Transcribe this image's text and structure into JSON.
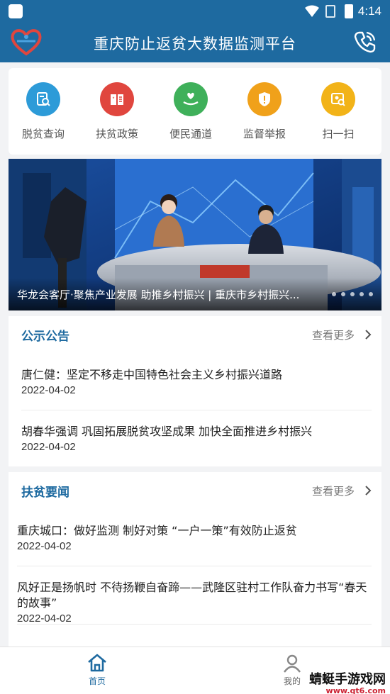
{
  "status": {
    "time": "4:14"
  },
  "app": {
    "title": "重庆防止返贫大数据监测平台"
  },
  "quick_menu": [
    {
      "label": "脱贫查询",
      "icon": "document-search-icon",
      "color": "#2d9bd8"
    },
    {
      "label": "扶贫政策",
      "icon": "policy-book-icon",
      "color": "#e0463e"
    },
    {
      "label": "便民通道",
      "icon": "hand-heart-icon",
      "color": "#3fb05a"
    },
    {
      "label": "监督举报",
      "icon": "shield-alert-icon",
      "color": "#f0a11a"
    },
    {
      "label": "扫一扫",
      "icon": "scan-icon",
      "color": "#f2b318"
    }
  ],
  "banner": {
    "caption": "华龙会客厅·聚焦产业发展 助推乡村振兴 | 重庆市乡村振兴..."
  },
  "announcements": {
    "title": "公示公告",
    "more": "查看更多",
    "items": [
      {
        "title": "唐仁健：坚定不移走中国特色社会主义乡村振兴道路",
        "date": "2022-04-02"
      },
      {
        "title": "胡春华强调 巩固拓展脱贫攻坚成果 加快全面推进乡村振兴",
        "date": "2022-04-02"
      }
    ]
  },
  "news": {
    "title": "扶贫要闻",
    "more": "查看更多",
    "items": [
      {
        "title": "重庆城口：做好监测 制好对策 “一户一策”有效防止返贫",
        "date": "2022-04-02"
      },
      {
        "title": "风好正是扬帆时 不待扬鞭自奋蹄——武隆区驻村工作队奋力书写“春天的故事”",
        "date": "2022-04-02"
      }
    ]
  },
  "nav": {
    "home": "首页",
    "mine": "我的"
  },
  "watermark": {
    "text": "蜻蜓手游戏网",
    "url": "www.qt6.com"
  },
  "colors": {
    "primary": "#1e6aa0"
  }
}
